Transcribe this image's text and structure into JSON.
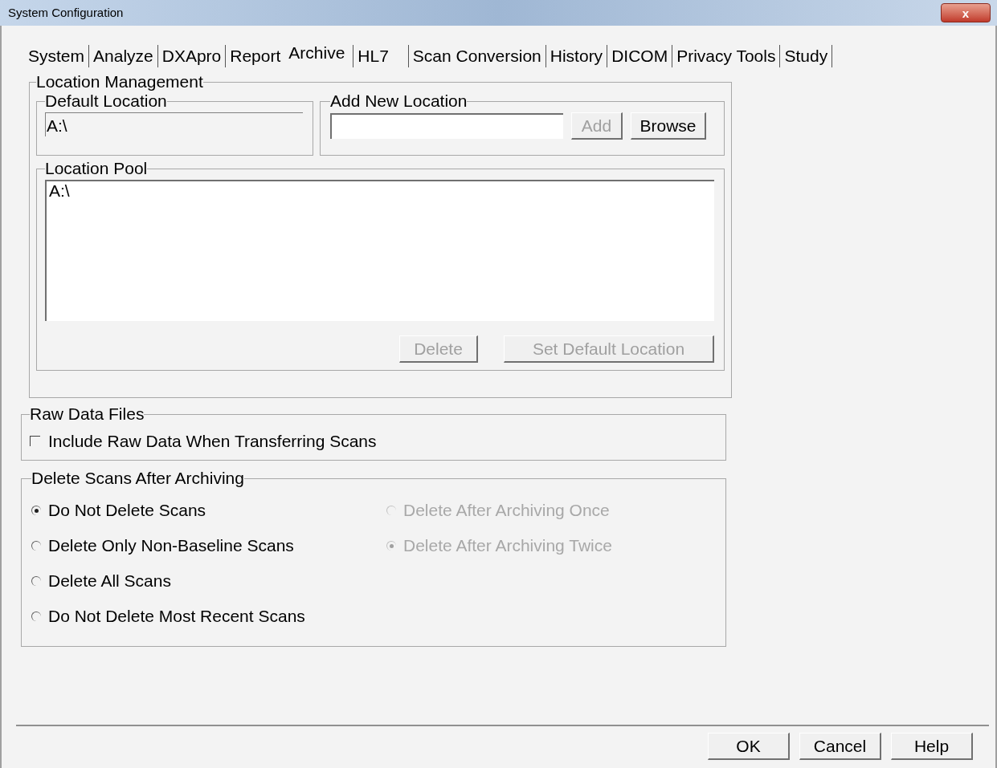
{
  "window": {
    "title": "System Configuration",
    "close": "x"
  },
  "tabs": [
    {
      "label": "System",
      "selected": false
    },
    {
      "label": "Analyze",
      "selected": false
    },
    {
      "label": "DXApro",
      "selected": false
    },
    {
      "label": "Report",
      "selected": false
    },
    {
      "label": "Archive",
      "selected": true
    },
    {
      "label": "HL7",
      "selected": false
    },
    {
      "label": "Scan Conversion",
      "selected": false
    },
    {
      "label": "History",
      "selected": false
    },
    {
      "label": "DICOM",
      "selected": false
    },
    {
      "label": "Privacy Tools",
      "selected": false
    },
    {
      "label": "Study",
      "selected": false
    }
  ],
  "location_management": {
    "title": "Location Management",
    "default_location": {
      "title": "Default Location",
      "value": "A:\\"
    },
    "add_new_location": {
      "title": "Add New Location",
      "buttons": [
        {
          "label": "Add",
          "disabled": true
        },
        {
          "label": "Browse",
          "disabled": false
        }
      ]
    },
    "location_pool": {
      "title": "Location Pool",
      "items": [
        "A:\\"
      ],
      "buttons": [
        {
          "label": "Delete",
          "disabled": true
        },
        {
          "label": "Set Default Location",
          "disabled": true
        }
      ]
    }
  },
  "raw_data_files": {
    "title": "Raw Data Files",
    "option": {
      "label": "Include Raw Data When Transferring Scans",
      "checked": false
    }
  },
  "delete_scans": {
    "title": "Delete Scans After Archiving",
    "options": [
      {
        "label": "Do Not Delete Scans",
        "selected": true,
        "disabled": false
      },
      {
        "label": "Delete Only Non-Baseline Scans",
        "selected": false,
        "disabled": false
      },
      {
        "label": "Delete All Scans",
        "selected": false,
        "disabled": false
      },
      {
        "label": "Do Not Delete Most Recent Scans",
        "selected": false,
        "disabled": false
      }
    ],
    "archive_options": [
      {
        "label": "Delete After Archiving Once",
        "selected": false,
        "disabled": true
      },
      {
        "label": "Delete After Archiving Twice",
        "selected": true,
        "disabled": true
      }
    ]
  },
  "buttons": [
    {
      "label": "OK",
      "disabled": false
    },
    {
      "label": "Cancel",
      "disabled": false
    },
    {
      "label": "Help",
      "disabled": false
    }
  ]
}
